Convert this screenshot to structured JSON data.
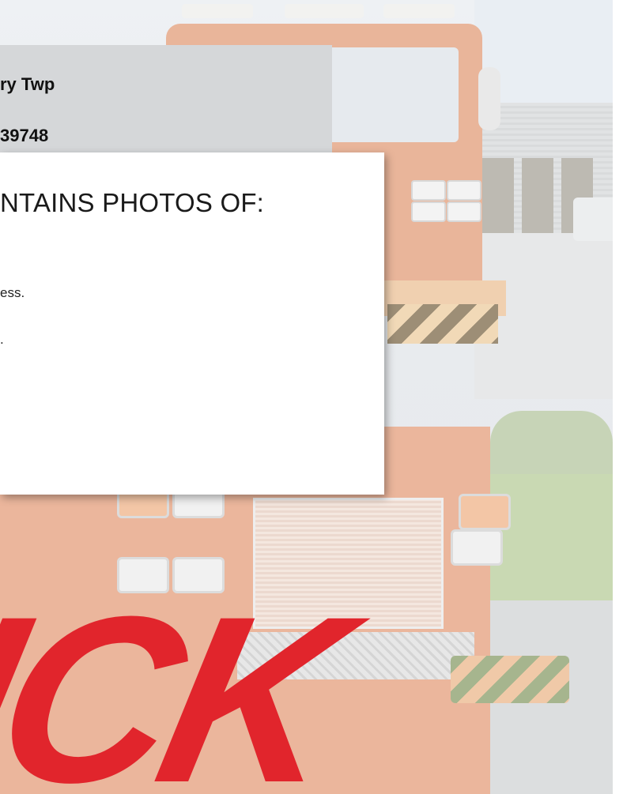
{
  "header": {
    "line1": "ry Twp",
    "line2": "39748"
  },
  "card": {
    "title": "NTAINS PHOTOS OF:",
    "items": [
      "ess.",
      "."
    ]
  },
  "brand": {
    "text": "ICK",
    "color": "#e1252c"
  },
  "colors": {
    "header_bg": "#d5d7d9",
    "card_bg": "#ffffff"
  }
}
